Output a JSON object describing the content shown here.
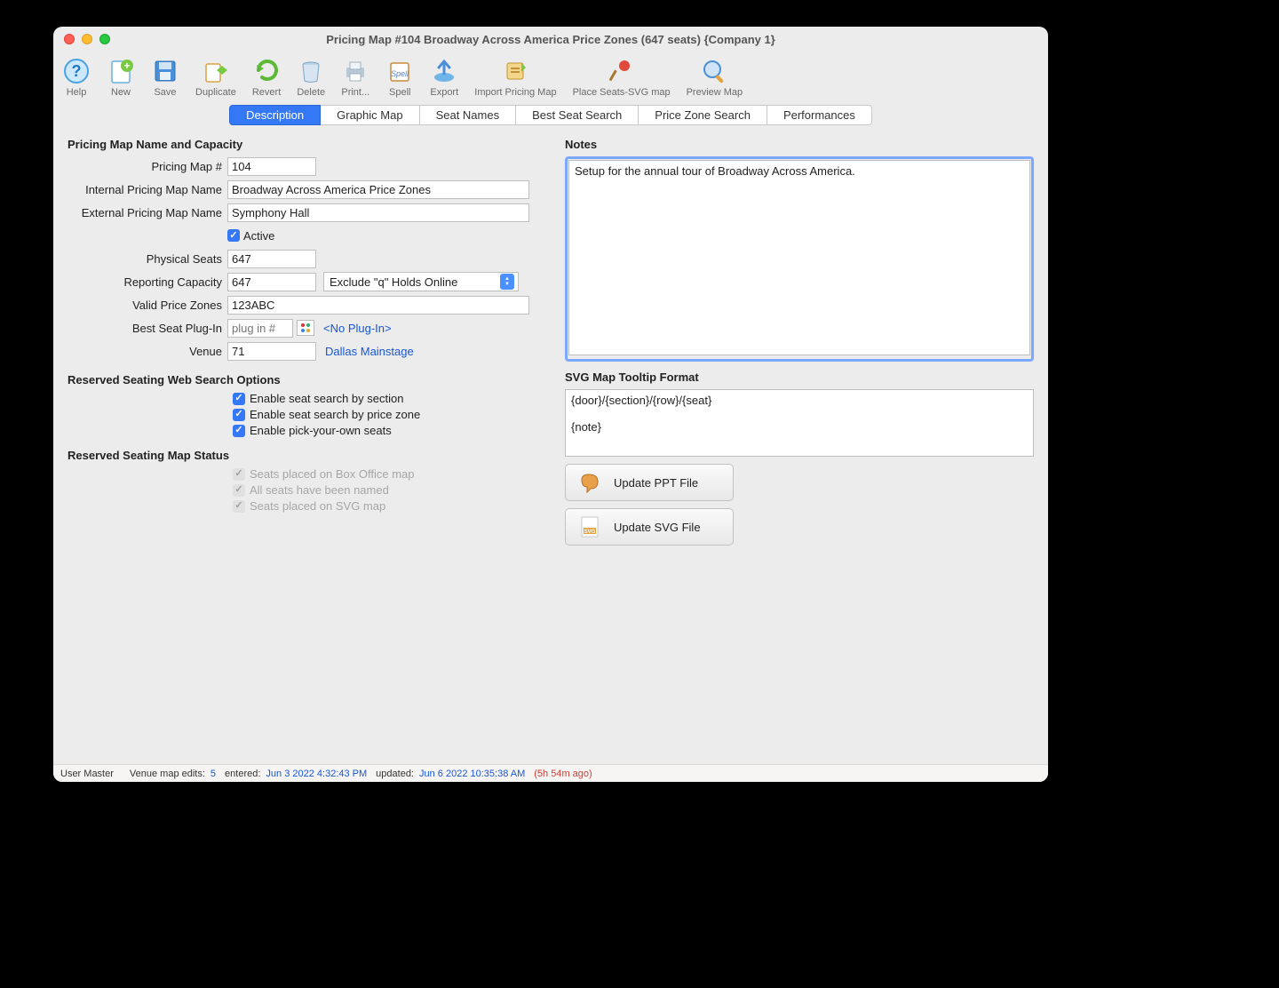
{
  "window": {
    "title": "Pricing Map #104 Broadway Across America Price Zones (647 seats) {Company 1}"
  },
  "toolbar": {
    "help": "Help",
    "new": "New",
    "save": "Save",
    "duplicate": "Duplicate",
    "revert": "Revert",
    "delete": "Delete",
    "print": "Print...",
    "spell": "Spell",
    "export": "Export",
    "import": "Import Pricing Map",
    "place": "Place Seats-SVG map",
    "preview": "Preview Map"
  },
  "tabs": {
    "description": "Description",
    "graphic": "Graphic Map",
    "seatnames": "Seat Names",
    "bestseat": "Best Seat Search",
    "pricezone": "Price Zone Search",
    "performances": "Performances"
  },
  "left": {
    "section1": "Pricing Map Name and Capacity",
    "pricing_map_num_label": "Pricing Map #",
    "pricing_map_num": "104",
    "internal_name_label": "Internal Pricing Map Name",
    "internal_name": "Broadway Across America Price Zones",
    "external_name_label": "External Pricing Map Name",
    "external_name": "Symphony Hall",
    "active_label": "Active",
    "physical_seats_label": "Physical Seats",
    "physical_seats": "647",
    "reporting_capacity_label": "Reporting Capacity",
    "reporting_capacity": "647",
    "holds_select": "Exclude \"q\" Holds Online",
    "valid_zones_label": "Valid Price Zones",
    "valid_zones": "123ABC",
    "best_seat_plugin_label": "Best Seat Plug-In",
    "best_seat_plugin_placeholder": "plug in #",
    "no_plugin": "<No Plug-In>",
    "venue_label": "Venue",
    "venue": "71",
    "venue_link": "Dallas Mainstage",
    "section2": "Reserved Seating Web Search Options",
    "enable_section": "Enable seat search by section",
    "enable_zone": "Enable seat search by price zone",
    "enable_pick": "Enable pick-your-own seats",
    "section3": "Reserved Seating Map Status",
    "status_box": "Seats placed on Box Office map",
    "status_named": "All seats have been named",
    "status_svg": "Seats placed on SVG map"
  },
  "right": {
    "notes_label": "Notes",
    "notes": "Setup for the annual tour of Broadway Across America.",
    "tooltip_label": "SVG Map Tooltip Format",
    "tooltip": "{door}/{section}/{row}/{seat}\n\n{note}",
    "update_ppt": "Update PPT File",
    "update_svg": "Update SVG File"
  },
  "status": {
    "user": "User Master",
    "edits_label": "Venue map edits:",
    "edits": "5",
    "entered_label": "entered:",
    "entered": "Jun 3 2022 4:32:43 PM",
    "updated_label": "updated:",
    "updated": "Jun 6 2022 10:35:38 AM",
    "ago": "(5h 54m ago)"
  }
}
